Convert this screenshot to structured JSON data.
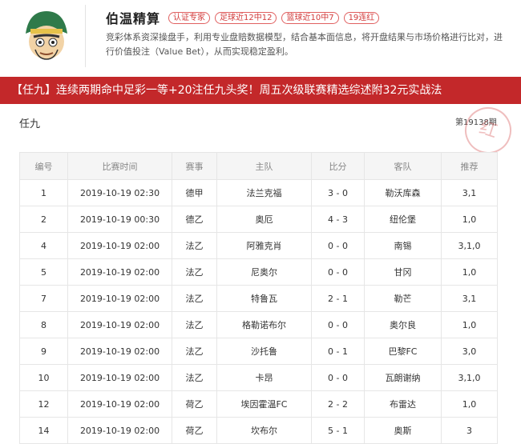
{
  "profile": {
    "name": "伯温精算",
    "badges": [
      "认证专家",
      "足球近12中12",
      "篮球近10中7",
      "19连红"
    ],
    "description": "竞彩体系资深操盘手，利用专业盘赔数据模型，结合基本面信息，将开盘结果与市场价格进行比对，进行价值投注（Value Bet），从而实现稳定盈利。"
  },
  "banner": {
    "text": "【任九】连续两期命中足彩一等+20注任九头奖！周五次级联赛精选综述附32元实战法"
  },
  "section": {
    "title": "任九",
    "issue": "第19138期",
    "stamp": "红"
  },
  "table": {
    "headers": [
      "编号",
      "比赛时间",
      "赛事",
      "主队",
      "比分",
      "客队",
      "推荐"
    ],
    "rows": [
      [
        "1",
        "2019-10-19 02:30",
        "德甲",
        "法兰克福",
        "3 - 0",
        "勒沃库森",
        "3,1"
      ],
      [
        "2",
        "2019-10-19 00:30",
        "德乙",
        "奥厄",
        "4 - 3",
        "纽伦堡",
        "1,0"
      ],
      [
        "4",
        "2019-10-19 02:00",
        "法乙",
        "阿雅克肖",
        "0 - 0",
        "南锡",
        "3,1,0"
      ],
      [
        "5",
        "2019-10-19 02:00",
        "法乙",
        "尼奥尔",
        "0 - 0",
        "甘冈",
        "1,0"
      ],
      [
        "7",
        "2019-10-19 02:00",
        "法乙",
        "特鲁瓦",
        "2 - 1",
        "勒芒",
        "3,1"
      ],
      [
        "8",
        "2019-10-19 02:00",
        "法乙",
        "格勒诺布尔",
        "0 - 0",
        "奥尔良",
        "1,0"
      ],
      [
        "9",
        "2019-10-19 02:00",
        "法乙",
        "沙托鲁",
        "0 - 1",
        "巴黎FC",
        "3,0"
      ],
      [
        "10",
        "2019-10-19 02:00",
        "法乙",
        "卡昂",
        "0 - 0",
        "瓦朗谢纳",
        "3,1,0"
      ],
      [
        "12",
        "2019-10-19 02:00",
        "荷乙",
        "埃因霍温FC",
        "2 - 2",
        "布雷达",
        "1,0"
      ],
      [
        "14",
        "2019-10-19 02:00",
        "荷乙",
        "坎布尔",
        "5 - 1",
        "奥斯",
        "3"
      ]
    ]
  },
  "colors": {
    "accent": "#c3282a",
    "badge": "#d23a3a",
    "header_bg": "#f5f5f5"
  },
  "icons": {
    "avatar": "cartoon-man-avatar"
  }
}
